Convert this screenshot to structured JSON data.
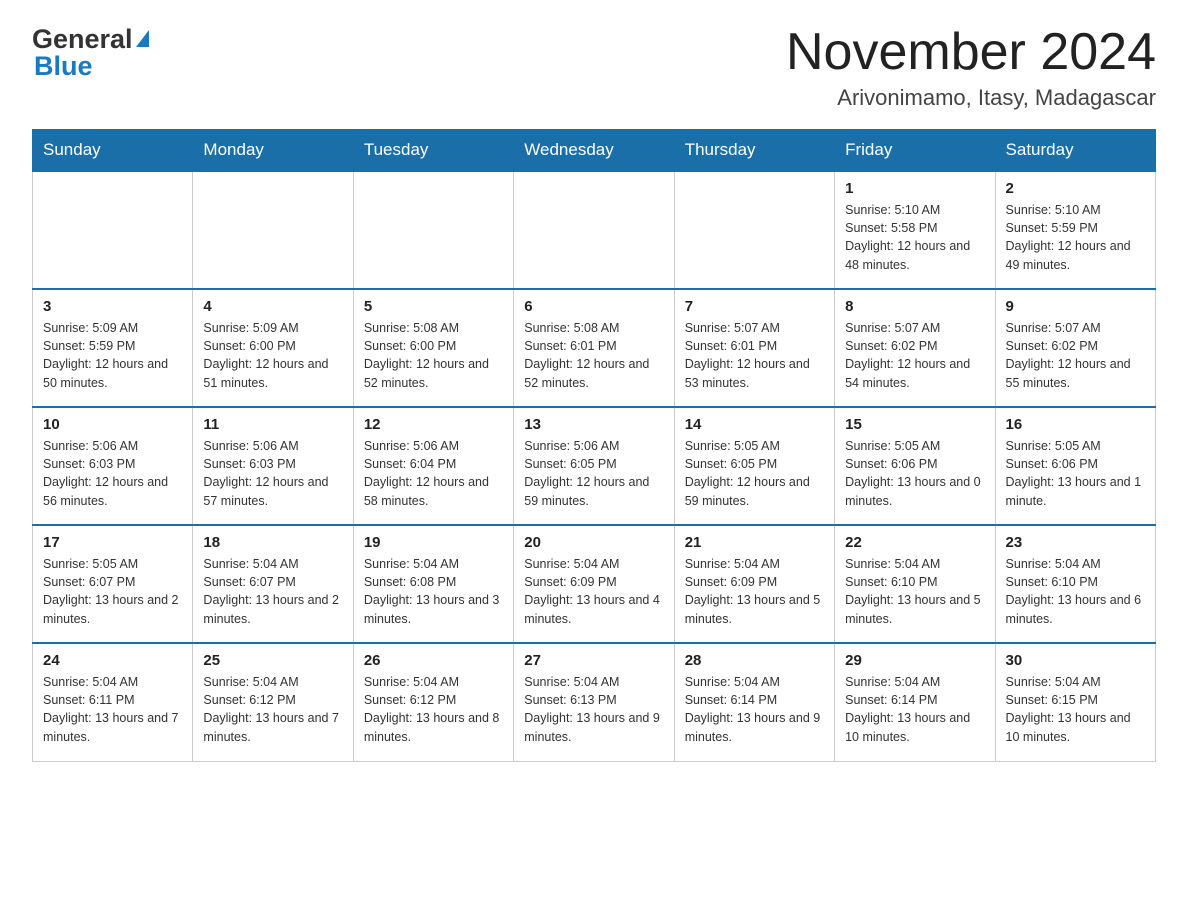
{
  "logo": {
    "general": "General",
    "blue": "Blue"
  },
  "title": "November 2024",
  "location": "Arivonimamo, Itasy, Madagascar",
  "days_of_week": [
    "Sunday",
    "Monday",
    "Tuesday",
    "Wednesday",
    "Thursday",
    "Friday",
    "Saturday"
  ],
  "weeks": [
    [
      {
        "day": "",
        "info": ""
      },
      {
        "day": "",
        "info": ""
      },
      {
        "day": "",
        "info": ""
      },
      {
        "day": "",
        "info": ""
      },
      {
        "day": "",
        "info": ""
      },
      {
        "day": "1",
        "info": "Sunrise: 5:10 AM\nSunset: 5:58 PM\nDaylight: 12 hours and 48 minutes."
      },
      {
        "day": "2",
        "info": "Sunrise: 5:10 AM\nSunset: 5:59 PM\nDaylight: 12 hours and 49 minutes."
      }
    ],
    [
      {
        "day": "3",
        "info": "Sunrise: 5:09 AM\nSunset: 5:59 PM\nDaylight: 12 hours and 50 minutes."
      },
      {
        "day": "4",
        "info": "Sunrise: 5:09 AM\nSunset: 6:00 PM\nDaylight: 12 hours and 51 minutes."
      },
      {
        "day": "5",
        "info": "Sunrise: 5:08 AM\nSunset: 6:00 PM\nDaylight: 12 hours and 52 minutes."
      },
      {
        "day": "6",
        "info": "Sunrise: 5:08 AM\nSunset: 6:01 PM\nDaylight: 12 hours and 52 minutes."
      },
      {
        "day": "7",
        "info": "Sunrise: 5:07 AM\nSunset: 6:01 PM\nDaylight: 12 hours and 53 minutes."
      },
      {
        "day": "8",
        "info": "Sunrise: 5:07 AM\nSunset: 6:02 PM\nDaylight: 12 hours and 54 minutes."
      },
      {
        "day": "9",
        "info": "Sunrise: 5:07 AM\nSunset: 6:02 PM\nDaylight: 12 hours and 55 minutes."
      }
    ],
    [
      {
        "day": "10",
        "info": "Sunrise: 5:06 AM\nSunset: 6:03 PM\nDaylight: 12 hours and 56 minutes."
      },
      {
        "day": "11",
        "info": "Sunrise: 5:06 AM\nSunset: 6:03 PM\nDaylight: 12 hours and 57 minutes."
      },
      {
        "day": "12",
        "info": "Sunrise: 5:06 AM\nSunset: 6:04 PM\nDaylight: 12 hours and 58 minutes."
      },
      {
        "day": "13",
        "info": "Sunrise: 5:06 AM\nSunset: 6:05 PM\nDaylight: 12 hours and 59 minutes."
      },
      {
        "day": "14",
        "info": "Sunrise: 5:05 AM\nSunset: 6:05 PM\nDaylight: 12 hours and 59 minutes."
      },
      {
        "day": "15",
        "info": "Sunrise: 5:05 AM\nSunset: 6:06 PM\nDaylight: 13 hours and 0 minutes."
      },
      {
        "day": "16",
        "info": "Sunrise: 5:05 AM\nSunset: 6:06 PM\nDaylight: 13 hours and 1 minute."
      }
    ],
    [
      {
        "day": "17",
        "info": "Sunrise: 5:05 AM\nSunset: 6:07 PM\nDaylight: 13 hours and 2 minutes."
      },
      {
        "day": "18",
        "info": "Sunrise: 5:04 AM\nSunset: 6:07 PM\nDaylight: 13 hours and 2 minutes."
      },
      {
        "day": "19",
        "info": "Sunrise: 5:04 AM\nSunset: 6:08 PM\nDaylight: 13 hours and 3 minutes."
      },
      {
        "day": "20",
        "info": "Sunrise: 5:04 AM\nSunset: 6:09 PM\nDaylight: 13 hours and 4 minutes."
      },
      {
        "day": "21",
        "info": "Sunrise: 5:04 AM\nSunset: 6:09 PM\nDaylight: 13 hours and 5 minutes."
      },
      {
        "day": "22",
        "info": "Sunrise: 5:04 AM\nSunset: 6:10 PM\nDaylight: 13 hours and 5 minutes."
      },
      {
        "day": "23",
        "info": "Sunrise: 5:04 AM\nSunset: 6:10 PM\nDaylight: 13 hours and 6 minutes."
      }
    ],
    [
      {
        "day": "24",
        "info": "Sunrise: 5:04 AM\nSunset: 6:11 PM\nDaylight: 13 hours and 7 minutes."
      },
      {
        "day": "25",
        "info": "Sunrise: 5:04 AM\nSunset: 6:12 PM\nDaylight: 13 hours and 7 minutes."
      },
      {
        "day": "26",
        "info": "Sunrise: 5:04 AM\nSunset: 6:12 PM\nDaylight: 13 hours and 8 minutes."
      },
      {
        "day": "27",
        "info": "Sunrise: 5:04 AM\nSunset: 6:13 PM\nDaylight: 13 hours and 9 minutes."
      },
      {
        "day": "28",
        "info": "Sunrise: 5:04 AM\nSunset: 6:14 PM\nDaylight: 13 hours and 9 minutes."
      },
      {
        "day": "29",
        "info": "Sunrise: 5:04 AM\nSunset: 6:14 PM\nDaylight: 13 hours and 10 minutes."
      },
      {
        "day": "30",
        "info": "Sunrise: 5:04 AM\nSunset: 6:15 PM\nDaylight: 13 hours and 10 minutes."
      }
    ]
  ]
}
